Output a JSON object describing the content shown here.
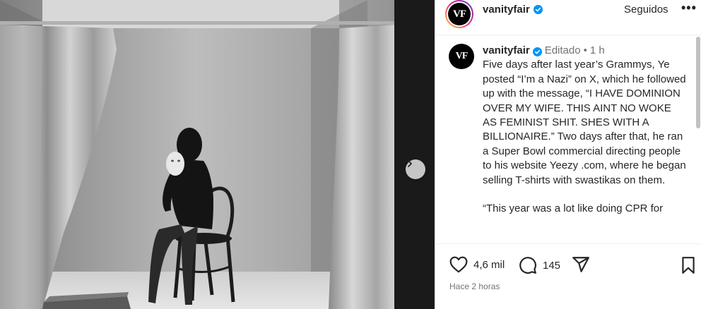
{
  "header": {
    "username": "vanityfair",
    "avatar_text": "VF",
    "follow_label": "Seguidos",
    "more_label": "•••"
  },
  "caption": {
    "avatar_text": "VF",
    "username": "vanityfair",
    "edited_label": "Editado",
    "dot": "•",
    "time": "1 h",
    "paragraph1": "Five days after last year’s Grammys, Ye posted “I’m a Nazi” on X, which he followed up with the message, “I HAVE DOMINION OVER MY WIFE. THIS AINT NO WOKE AS FEMINIST SHIT. SHES WITH A BILLIONAIRE.” Two days after that, he ran a Super Bowl commercial directing people to his website Yeezy .com, where he began selling T-shirts with swastikas on them.",
    "paragraph2": "“This year was a lot like doing CPR for"
  },
  "actions": {
    "likes": "4,6 mil",
    "comments": "145",
    "time_ago": "Hace 2 horas"
  },
  "icons": {
    "verified": "verified-badge-icon",
    "like": "heart-icon",
    "comment": "comment-icon",
    "share": "send-icon",
    "save": "bookmark-icon",
    "next": "chevron-right-icon"
  },
  "colors": {
    "verified": "#0095f6",
    "muted_text": "#737373"
  }
}
